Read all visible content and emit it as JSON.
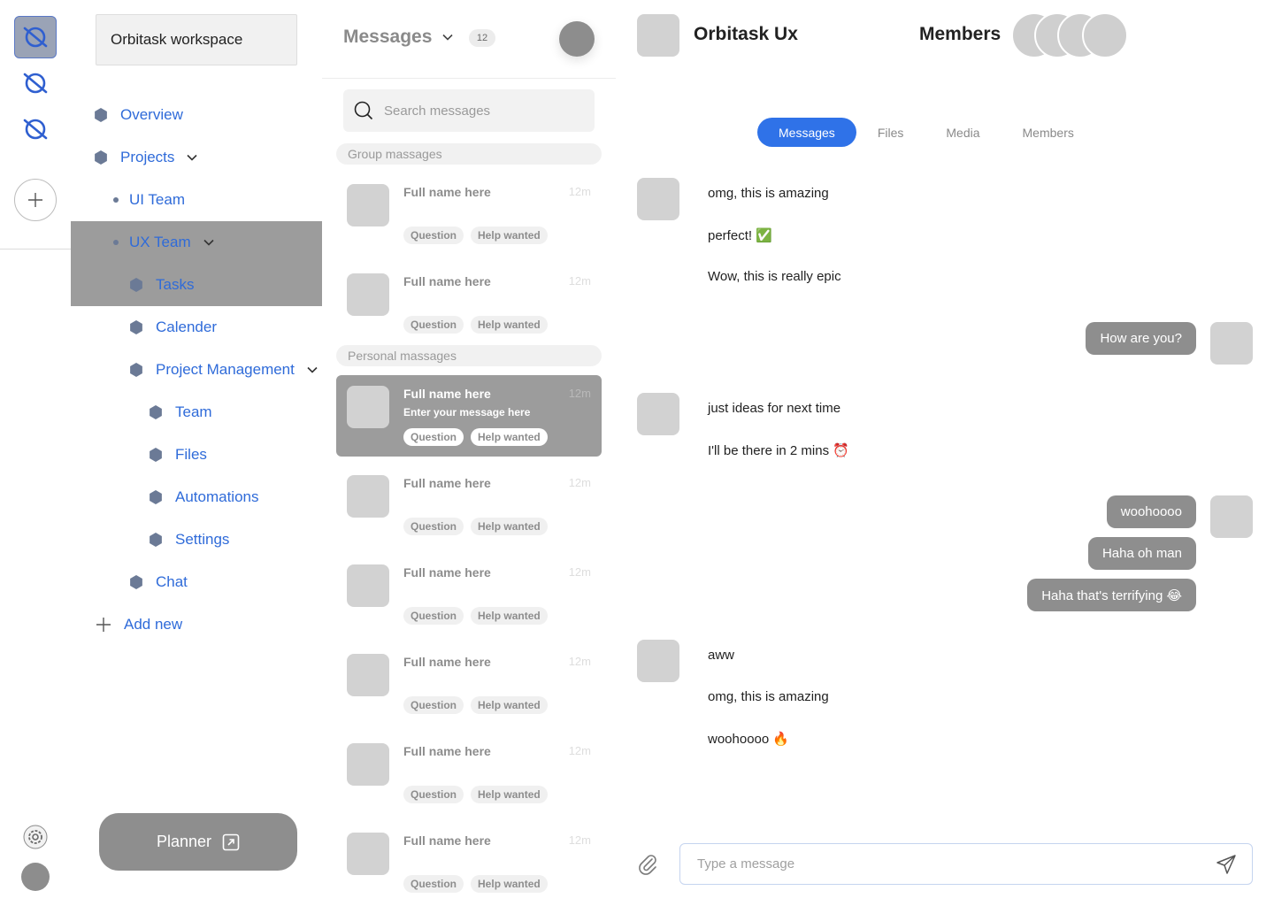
{
  "workspace": {
    "name": "Orbitask workspace"
  },
  "nav": {
    "overview": "Overview",
    "projects": "Projects",
    "ui_team": "UI Team",
    "ux_team": "UX Team",
    "tasks": "Tasks",
    "calender": "Calender",
    "project_management": "Project Management",
    "team": "Team",
    "files": "Files",
    "automations": "Automations",
    "settings": "Settings",
    "chat": "Chat",
    "add_new": "Add new"
  },
  "planner": {
    "label": "Planner"
  },
  "message_list": {
    "title": "Messages",
    "count": "12",
    "search_placeholder": "Search messages",
    "group_label": "Group massages",
    "personal_label": "Personal massages",
    "conversations": [
      {
        "name": "Full name here",
        "time": "12m",
        "tags": [
          "Question",
          "Help wanted"
        ]
      },
      {
        "name": "Full name here",
        "time": "12m",
        "tags": [
          "Question",
          "Help wanted"
        ]
      },
      {
        "name": "Full name here",
        "time": "12m",
        "preview": "Enter your message here",
        "tags": [
          "Question",
          "Help wanted"
        ]
      },
      {
        "name": "Full name here",
        "time": "12m",
        "tags": [
          "Question",
          "Help wanted"
        ]
      },
      {
        "name": "Full name here",
        "time": "12m",
        "tags": [
          "Question",
          "Help wanted"
        ]
      },
      {
        "name": "Full name here",
        "time": "12m",
        "tags": [
          "Question",
          "Help wanted"
        ]
      },
      {
        "name": "Full name here",
        "time": "12m",
        "tags": [
          "Question",
          "Help wanted"
        ]
      },
      {
        "name": "Full name here",
        "time": "12m",
        "tags": [
          "Question",
          "Help wanted"
        ]
      }
    ]
  },
  "chat": {
    "title": "Orbitask Ux",
    "members_label": "Members",
    "tabs": [
      "Messages",
      "Files",
      "Media",
      "Members"
    ],
    "messages": [
      {
        "dir": "in",
        "text": "omg, this is amazing"
      },
      {
        "dir": "in",
        "text": "perfect! ✅"
      },
      {
        "dir": "in",
        "text": "Wow, this is really epic"
      },
      {
        "dir": "out",
        "text": "How are you?"
      },
      {
        "dir": "in",
        "text": "just ideas for next time"
      },
      {
        "dir": "in",
        "text": "I'll be there in 2 mins ⏰"
      },
      {
        "dir": "out",
        "text": "woohoooo"
      },
      {
        "dir": "out",
        "text": "Haha oh man"
      },
      {
        "dir": "out",
        "text": "Haha that's terrifying 😂"
      },
      {
        "dir": "in",
        "text": "aww"
      },
      {
        "dir": "in",
        "text": "omg, this is amazing"
      },
      {
        "dir": "in",
        "text": "woohoooo 🔥"
      }
    ],
    "composer_placeholder": "Type a message"
  },
  "colors": {
    "accent": "#2f72e8",
    "link": "#2f6bd9",
    "bubble_out": "#8e8e8e",
    "highlight": "#9c9c9c"
  }
}
